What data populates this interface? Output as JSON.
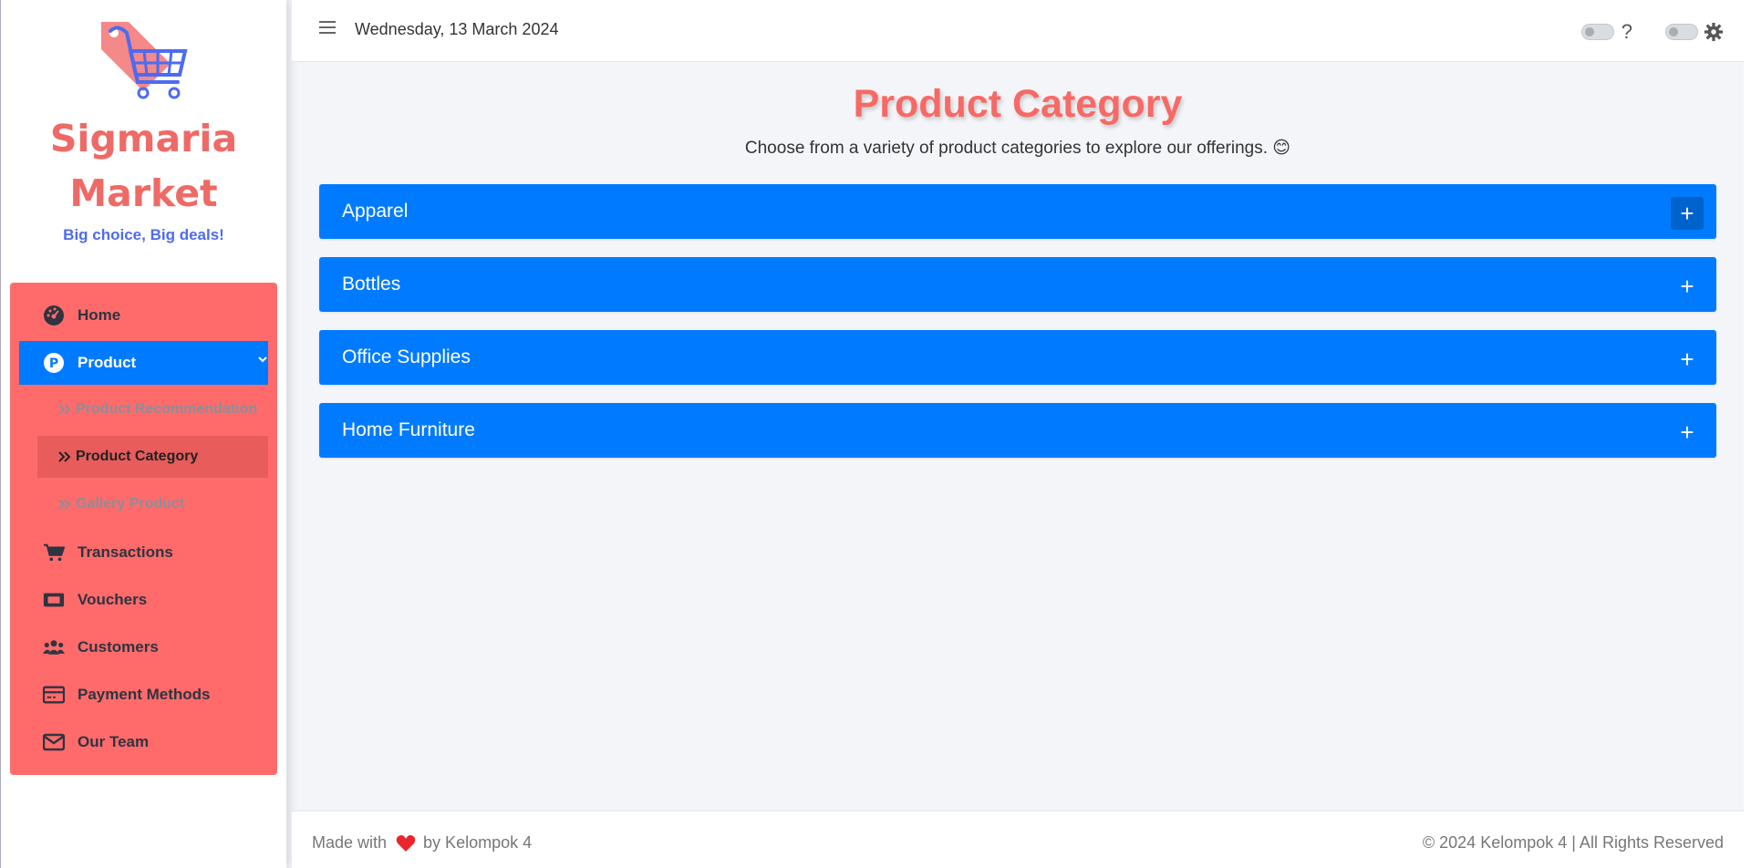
{
  "brand": {
    "name_line1": "Sigmaria",
    "name_line2": "Market",
    "tagline": "Big choice, Big deals!",
    "logo_icon": "shopping-cart-tag-icon"
  },
  "sidebar": {
    "items": [
      {
        "label": "Home",
        "icon": "dashboard-icon"
      },
      {
        "label": "Product",
        "icon": "product-p-icon",
        "active": true
      },
      {
        "label": "Transactions",
        "icon": "cart-icon"
      },
      {
        "label": "Vouchers",
        "icon": "ticket-icon"
      },
      {
        "label": "Customers",
        "icon": "users-icon"
      },
      {
        "label": "Payment Methods",
        "icon": "credit-card-icon"
      },
      {
        "label": "Our Team",
        "icon": "envelope-icon"
      }
    ],
    "product_sub": [
      {
        "label": "Product Recommendation",
        "icon": "double-chevron-icon"
      },
      {
        "label": "Product Category",
        "icon": "double-chevron-icon",
        "current": true
      },
      {
        "label": "Gallery Product",
        "icon": "double-chevron-icon"
      }
    ]
  },
  "header": {
    "date": "Wednesday, 13 March 2024",
    "help_label": "?"
  },
  "main": {
    "title": "Product Category",
    "subtitle": "Choose from a variety of product categories to explore our offerings. 😊",
    "categories": [
      {
        "label": "Apparel",
        "expand_label": "+"
      },
      {
        "label": "Bottles",
        "expand_label": "+"
      },
      {
        "label": "Office Supplies",
        "expand_label": "+"
      },
      {
        "label": "Home Furniture",
        "expand_label": "+"
      }
    ]
  },
  "footer": {
    "made_with": "Made with",
    "by": "by Kelompok 4",
    "copyright": "© 2024 Kelompok 4 | All Rights Reserved"
  },
  "colors": {
    "accent_blue": "#007bff",
    "menu_red": "#ff6b6b",
    "brand_red": "#ee6a66",
    "tagline_blue": "#4d6bf0"
  }
}
